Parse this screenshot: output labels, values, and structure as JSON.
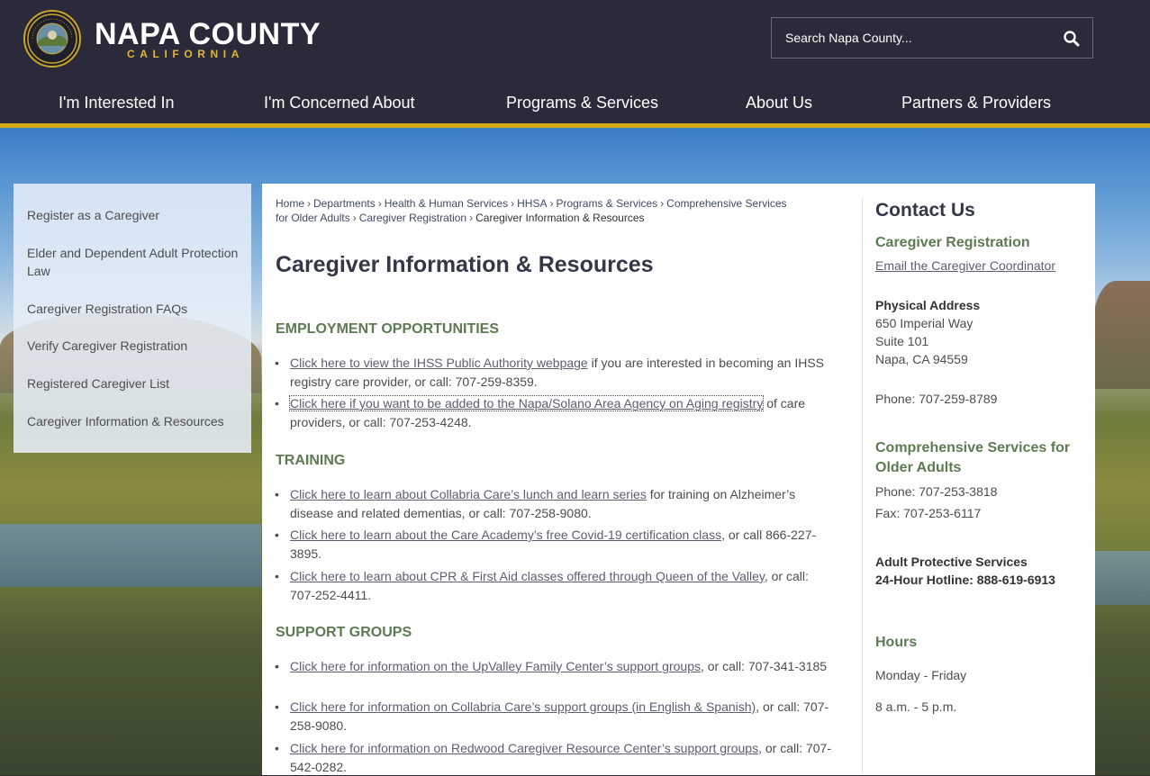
{
  "header": {
    "logo_title": "NAPA COUNTY",
    "logo_subtitle": "CALIFORNIA",
    "seal_text": "NAPA COUNTY · CALIFORNIA",
    "search_placeholder": "Search Napa County...",
    "accent_color": "#d4a915"
  },
  "nav": {
    "items": [
      {
        "label": "I'm Interested In"
      },
      {
        "label": "I'm Concerned About"
      },
      {
        "label": "Programs & Services"
      },
      {
        "label": "About Us"
      },
      {
        "label": "Partners & Providers"
      }
    ]
  },
  "sidebar": {
    "items": [
      {
        "label": "Register as a Caregiver"
      },
      {
        "label": "Elder and Dependent Adult Protection Law"
      },
      {
        "label": "Caregiver Registration FAQs"
      },
      {
        "label": "Verify Caregiver Registration"
      },
      {
        "label": "Registered Caregiver List"
      },
      {
        "label": "Caregiver Information & Resources"
      }
    ]
  },
  "breadcrumb": {
    "items": [
      {
        "label": "Home"
      },
      {
        "label": "Departments"
      },
      {
        "label": "Health & Human Services"
      },
      {
        "label": "HHSA"
      },
      {
        "label": "Programs & Services"
      },
      {
        "label": "Comprehensive Services for Older Adults"
      },
      {
        "label": "Caregiver Registration"
      }
    ],
    "current": "Caregiver Information & Resources"
  },
  "main": {
    "title": "Caregiver Information & Resources",
    "sections": [
      {
        "heading": "EMPLOYMENT OPPORTUNITIES",
        "items": [
          {
            "link": "Click here to view the IHSS Public Authority webpage",
            "text": " if you are interested in becoming an IHSS registry care provider, or call: 707-259-8359."
          },
          {
            "link": "Click here if you want to be added to the Napa/Solano Area Agency on Aging registry",
            "text": " of care providers, or call: 707-253-4248."
          }
        ]
      },
      {
        "heading": "TRAINING",
        "items": [
          {
            "link": "Click here to learn about Collabria Care’s lunch and learn series",
            "text": " for training on Alzheimer’s disease and related dementias, or call: 707-258-9080."
          },
          {
            "link": "Click here to learn about the Care Academy’s free Covid-19 certification class",
            "text": ", or call 866-227-3895."
          },
          {
            "link": "Click here to learn about CPR & First Aid classes offered through Queen of the Valley",
            "text": ", or call: 707-252-4411."
          }
        ]
      },
      {
        "heading": "SUPPORT GROUPS",
        "items": [
          {
            "link": "Click here for information on the UpValley Family Center’s support groups",
            "text": ", or call: 707-341-3185"
          },
          {
            "link": "Click here for information on Collabria Care’s support groups (in English & Spanish)",
            "text": ", or call: 707-258-9080."
          },
          {
            "link": "Click here for information on Redwood Caregiver Resource Center’s support groups",
            "text": ", or call: 707-542-0282."
          }
        ]
      }
    ]
  },
  "contact": {
    "title": "Contact Us",
    "registration_heading": "Caregiver Registration",
    "email_link": "Email the Caregiver Coordinator",
    "address_label": "Physical Address",
    "address_line1": "650 Imperial Way",
    "address_line2": "Suite 101",
    "address_line3": "Napa, CA 94559",
    "phone1": "Phone: 707-259-8789",
    "older_adults_heading": "Comprehensive Services for Older Adults",
    "phone2": "Phone: 707-253-3818",
    "fax": "Fax: 707-253-6117",
    "aps_label": "Adult Protective Services",
    "aps_hotline": "24-Hour Hotline: 888-619-6913",
    "hours_heading": "Hours",
    "hours_days": "Monday - Friday",
    "hours_time": "8 a.m. - 5 p.m."
  }
}
